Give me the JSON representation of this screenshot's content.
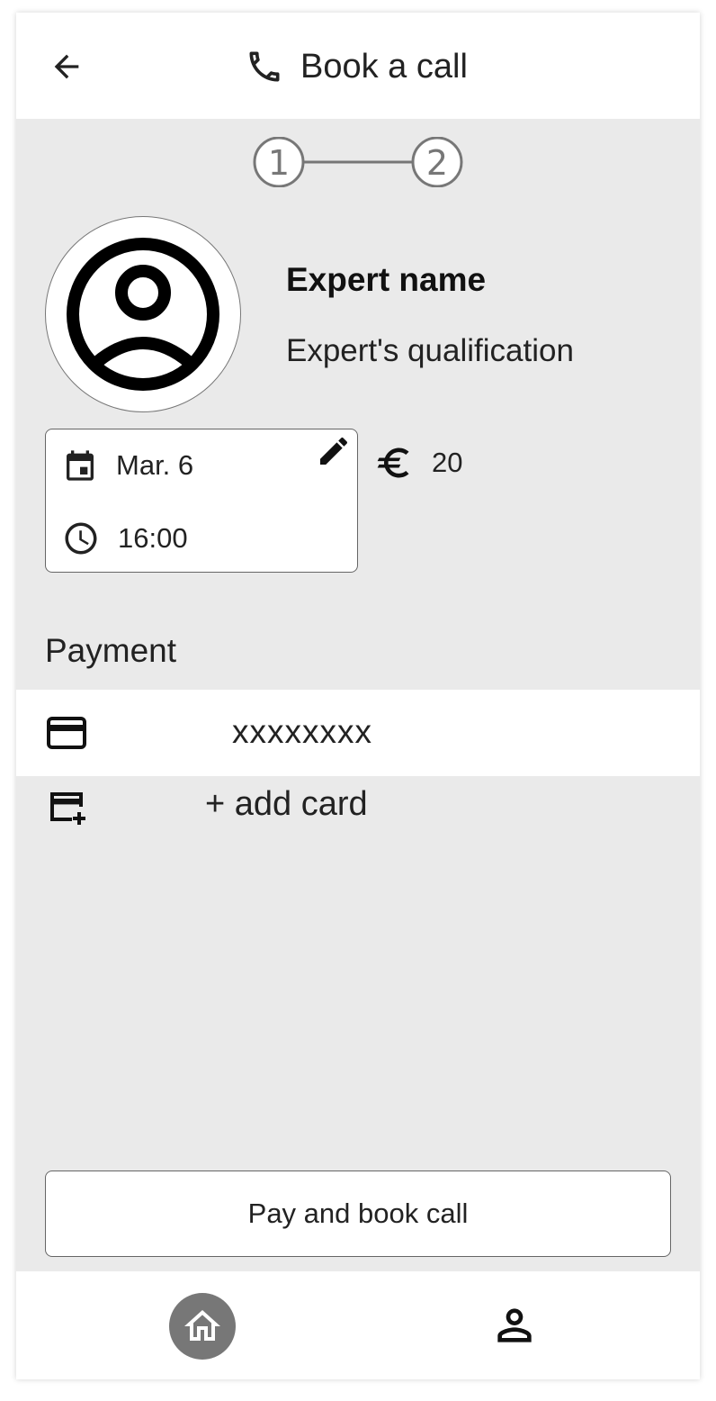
{
  "header": {
    "title": "Book a call",
    "back_icon": "arrow-left-icon",
    "title_icon": "phone-icon"
  },
  "stepper": {
    "steps": [
      "1",
      "2"
    ]
  },
  "expert": {
    "name": "Expert name",
    "qualification": "Expert's qualification",
    "avatar_icon": "account-circle-icon"
  },
  "booking": {
    "date": "Mar. 6",
    "time": "16:00",
    "price": "20",
    "currency_icon": "euro-icon"
  },
  "payment": {
    "label": "Payment",
    "card_number": "xxxxxxxx",
    "add_card_label": "+ add card"
  },
  "actions": {
    "pay_label": "Pay and book call"
  },
  "nav": {
    "items": [
      "home-icon",
      "profile-icon"
    ]
  },
  "colors": {
    "background": "#eaeaea",
    "surface": "#ffffff",
    "active_nav": "#777777"
  }
}
